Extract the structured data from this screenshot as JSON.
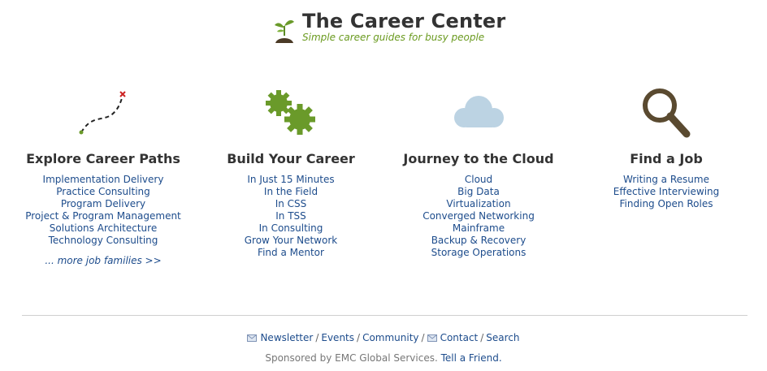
{
  "header": {
    "title": "The Career Center",
    "tagline": "Simple career guides for busy people"
  },
  "colors": {
    "link": "#1d4c8c",
    "tagline_green": "#6a9a1f",
    "gear_green": "#6a9a2a",
    "cloud_blue": "#bcd3e3",
    "magnifier_brown": "#5a4a30",
    "path_x_red": "#cc2222"
  },
  "columns": [
    {
      "icon": "dotted-path-icon",
      "heading": "Explore Career Paths",
      "links": [
        "Implementation Delivery",
        "Practice Consulting",
        "Program Delivery",
        "Project & Program Management",
        "Solutions Architecture",
        "Technology Consulting"
      ],
      "more": "... more job families >>"
    },
    {
      "icon": "gears-icon",
      "heading": "Build Your Career",
      "links": [
        "In Just 15 Minutes",
        "In the Field",
        "In CSS",
        "In TSS",
        "In Consulting",
        "Grow Your Network",
        "Find a Mentor"
      ]
    },
    {
      "icon": "cloud-icon",
      "heading": "Journey to the Cloud",
      "links": [
        "Cloud",
        "Big Data",
        "Virtualization",
        "Converged Networking",
        "Mainframe",
        "Backup & Recovery",
        "Storage Operations"
      ]
    },
    {
      "icon": "magnifier-icon",
      "heading": "Find a Job",
      "links": [
        "Writing a Resume",
        "Effective Interviewing",
        "Finding Open Roles"
      ]
    }
  ],
  "footer": {
    "nav": [
      "Newsletter",
      "Events",
      "Community",
      "Contact",
      "Search"
    ],
    "separator": "/",
    "sponsor_text": "Sponsored by EMC Global Services.",
    "tell_friend": "Tell a Friend."
  }
}
